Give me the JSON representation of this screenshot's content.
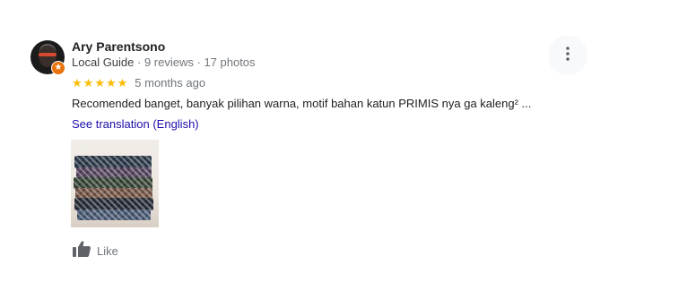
{
  "review": {
    "reviewer_name": "Ary Parentsono",
    "reviewer_level": "Local Guide",
    "reviewer_reviews": "9 reviews",
    "reviewer_photos": "17 photos",
    "meta_separator": " · ",
    "rating": 5,
    "rating_max": 5,
    "time_ago": "5 months ago",
    "text": "Recomended banget, banyak pilihan warna, motif bahan katun PRIMIS nya ga kaleng² ...",
    "translation_link": "See translation (English)",
    "like_label": "Like"
  },
  "colors": {
    "star": "#fbbc04",
    "link": "#1a0dab",
    "muted": "#70757a",
    "badge": "#e8710a"
  },
  "icons": {
    "avatar": "reviewer-avatar",
    "badge": "local-guide-badge-icon",
    "like": "thumbs-up-icon",
    "more": "more-vertical-icon"
  }
}
